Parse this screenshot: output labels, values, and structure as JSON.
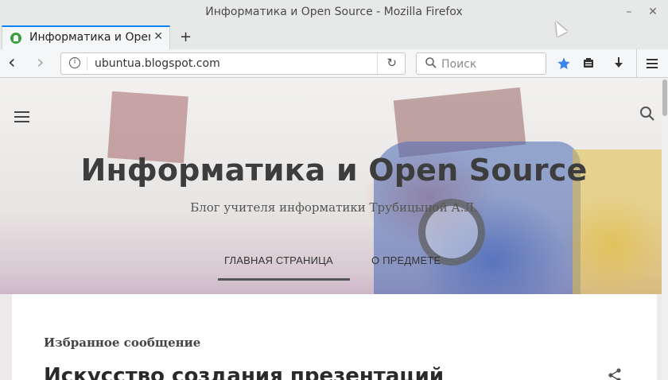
{
  "window": {
    "title": "Информатика и Open Source - Mozilla Firefox",
    "minimize_glyph": "–",
    "close_glyph": "✕"
  },
  "tabs": [
    {
      "label": "Информатика и Open Source",
      "close_glyph": "✕",
      "active": true
    }
  ],
  "newtab_glyph": "+",
  "nav": {
    "back_glyph": "‹",
    "forward_glyph": "›",
    "url": "ubuntua.blogspot.com",
    "reload_glyph": "↻",
    "search_placeholder": "Поиск",
    "icons": [
      "info-icon",
      "reload-icon",
      "search-icon",
      "star-icon",
      "reading-list-icon",
      "download-icon",
      "menu-icon"
    ]
  },
  "page": {
    "blog_title": "Информатика и Open Source",
    "blog_subtitle": "Блог учителя информатики Трубицыной А.Л.",
    "menu": [
      {
        "label": "ГЛАВНАЯ СТРАНИЦА",
        "active": true
      },
      {
        "label": "О ПРЕДМЕТЕ",
        "active": false
      }
    ],
    "featured_label": "Избранное сообщение",
    "post_title": "Искусство создания презентаций"
  },
  "colors": {
    "accent": "#0a84ff",
    "star": "#3a84ea",
    "favicon": "#3e9f41"
  }
}
